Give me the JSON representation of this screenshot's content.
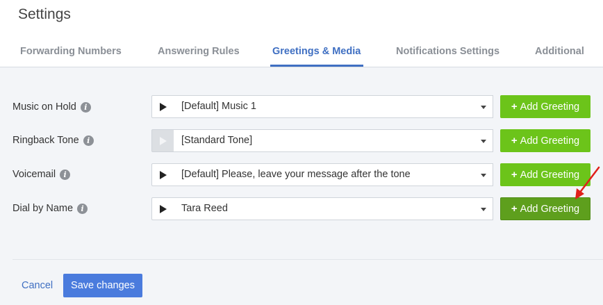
{
  "header": {
    "title": "Settings"
  },
  "tabs": [
    {
      "label": "Forwarding Numbers"
    },
    {
      "label": "Answering Rules"
    },
    {
      "label": "Greetings & Media"
    },
    {
      "label": "Notifications Settings"
    },
    {
      "label": "Additional"
    }
  ],
  "rows": [
    {
      "label": "Music on Hold",
      "value": "[Default] Music 1",
      "button": "Add Greeting"
    },
    {
      "label": "Ringback Tone",
      "value": "[Standard Tone]",
      "button": "Add Greeting"
    },
    {
      "label": "Voicemail",
      "value": "[Default] Please, leave your message after the tone",
      "button": "Add Greeting"
    },
    {
      "label": "Dial by Name",
      "value": "Tara Reed",
      "button": "Add Greeting"
    }
  ],
  "footer": {
    "cancel": "Cancel",
    "save": "Save changes"
  },
  "colors": {
    "accent": "#3f6fc2",
    "add_button": "#6cc41a",
    "add_button_hover": "#5e9f1d",
    "save_button": "#4a7bdd",
    "annotation_arrow": "#e0201b"
  }
}
